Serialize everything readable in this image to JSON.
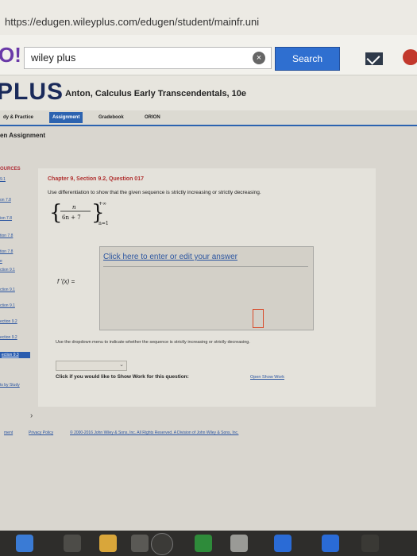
{
  "browser": {
    "url": "https://edugen.wileyplus.com/edugen/student/mainfr.uni"
  },
  "searchbar": {
    "logo": "O!",
    "query": "wiley plus",
    "clear_icon": "close-icon",
    "button_label": "Search",
    "mail_icon": "mail-icon",
    "settings_icon": "gear-icon"
  },
  "header": {
    "brand": "PLUS",
    "course": "Anton, Calculus Early Transcendentals, 10e"
  },
  "nav": {
    "tabs": [
      {
        "label": "dy & Practice"
      },
      {
        "label": "Assignment"
      },
      {
        "label": "Gradebook"
      },
      {
        "label": "ORION"
      }
    ]
  },
  "subheader": "en Assignment",
  "sidebar": {
    "heading": "OURCES",
    "items": [
      "9.1",
      "on 7.8",
      "ion 7.8",
      "tion 7.8",
      "tion 7.8",
      "e",
      "ction 9.1",
      "ction 9.1",
      "ction 9.1",
      "ection 9.2",
      "ection 9.2",
      "ection 9.3",
      "ts by Study"
    ]
  },
  "question": {
    "title": "Chapter 9, Section 9.2, Question 017",
    "instruction": "Use differentiation to show that the given sequence is strictly increasing or strictly decreasing.",
    "sequence": "{ n / (6n + 7) } n=1 to +∞",
    "seq_num": "n",
    "seq_den": "6n + 7",
    "seq_sup": "+∞",
    "seq_sub": "n=1",
    "fprime_label": "f '(x) =",
    "answer_link": "Click here to enter or edit your answer",
    "dropdown_instruction": "Use the dropdown menu to indicate whether the sequence is strictly increasing or strictly decreasing.",
    "dropdown_value": "",
    "show_work_label": "Click if you would like to Show Work for this question:",
    "show_work_link": "Open Show Work"
  },
  "footer": {
    "links": [
      "ment",
      "Privacy Policy",
      "© 2000-2016 John Wiley & Sons, Inc. All Rights Reserved. A Division of John Wiley & Sons, Inc."
    ]
  },
  "colors": {
    "accent": "#2c63b0",
    "title_red": "#b0302f",
    "link": "#2b55a0"
  }
}
